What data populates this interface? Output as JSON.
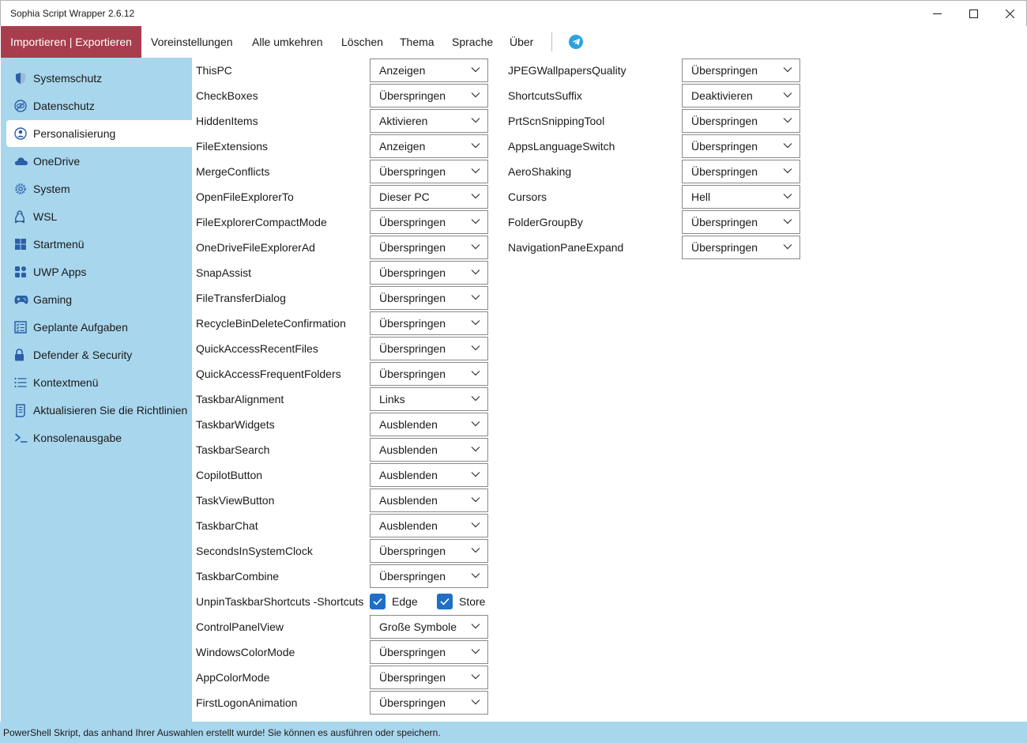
{
  "window": {
    "title": "Sophia Script Wrapper 2.6.12"
  },
  "menu": {
    "active": "Importieren | Exportieren",
    "items": [
      "Voreinstellungen",
      "Alle umkehren",
      "Löschen",
      "Thema",
      "Sprache",
      "Über"
    ],
    "telegram_icon": "telegram-icon"
  },
  "sidebar": {
    "items": [
      {
        "label": "Systemschutz",
        "icon": "shield-icon"
      },
      {
        "label": "Datenschutz",
        "icon": "eye-icon"
      },
      {
        "label": "Personalisierung",
        "icon": "user-icon"
      },
      {
        "label": "OneDrive",
        "icon": "cloud-icon"
      },
      {
        "label": "System",
        "icon": "gear-icon"
      },
      {
        "label": "WSL",
        "icon": "linux-icon"
      },
      {
        "label": "Startmenü",
        "icon": "windows-icon"
      },
      {
        "label": "UWP Apps",
        "icon": "apps-icon"
      },
      {
        "label": "Gaming",
        "icon": "gamepad-icon"
      },
      {
        "label": "Geplante Aufgaben",
        "icon": "tasklist-icon"
      },
      {
        "label": "Defender & Security",
        "icon": "lock-icon"
      },
      {
        "label": "Kontextmenü",
        "icon": "list-icon"
      },
      {
        "label": "Aktualisieren Sie die Richtlinien",
        "icon": "scroll-icon"
      },
      {
        "label": "Konsolenausgabe",
        "icon": "console-icon"
      }
    ],
    "selected": "Personalisierung"
  },
  "left_settings": [
    {
      "name": "ThisPC",
      "value": "Anzeigen"
    },
    {
      "name": "CheckBoxes",
      "value": "Überspringen"
    },
    {
      "name": "HiddenItems",
      "value": "Aktivieren"
    },
    {
      "name": "FileExtensions",
      "value": "Anzeigen"
    },
    {
      "name": "MergeConflicts",
      "value": "Überspringen"
    },
    {
      "name": "OpenFileExplorerTo",
      "value": "Dieser PC"
    },
    {
      "name": "FileExplorerCompactMode",
      "value": "Überspringen"
    },
    {
      "name": "OneDriveFileExplorerAd",
      "value": "Überspringen"
    },
    {
      "name": "SnapAssist",
      "value": "Überspringen"
    },
    {
      "name": "FileTransferDialog",
      "value": "Überspringen"
    },
    {
      "name": "RecycleBinDeleteConfirmation",
      "value": "Überspringen"
    },
    {
      "name": "QuickAccessRecentFiles",
      "value": "Überspringen"
    },
    {
      "name": "QuickAccessFrequentFolders",
      "value": "Überspringen"
    },
    {
      "name": "TaskbarAlignment",
      "value": "Links"
    },
    {
      "name": "TaskbarWidgets",
      "value": "Ausblenden"
    },
    {
      "name": "TaskbarSearch",
      "value": "Ausblenden"
    },
    {
      "name": "CopilotButton",
      "value": "Ausblenden"
    },
    {
      "name": "TaskViewButton",
      "value": "Ausblenden"
    },
    {
      "name": "TaskbarChat",
      "value": "Ausblenden"
    },
    {
      "name": "SecondsInSystemClock",
      "value": "Überspringen"
    },
    {
      "name": "TaskbarCombine",
      "value": "Überspringen"
    },
    {
      "name": "UnpinTaskbarShortcuts -Shortcuts",
      "checkboxes": [
        {
          "label": "Edge",
          "checked": true
        },
        {
          "label": "Store",
          "checked": true
        }
      ]
    },
    {
      "name": "ControlPanelView",
      "value": "Große Symbole"
    },
    {
      "name": "WindowsColorMode",
      "value": "Überspringen"
    },
    {
      "name": "AppColorMode",
      "value": "Überspringen"
    },
    {
      "name": "FirstLogonAnimation",
      "value": "Überspringen"
    }
  ],
  "right_settings": [
    {
      "name": "JPEGWallpapersQuality",
      "value": "Überspringen"
    },
    {
      "name": "ShortcutsSuffix",
      "value": "Deaktivieren"
    },
    {
      "name": "PrtScnSnippingTool",
      "value": "Überspringen"
    },
    {
      "name": "AppsLanguageSwitch",
      "value": "Überspringen"
    },
    {
      "name": "AeroShaking",
      "value": "Überspringen"
    },
    {
      "name": "Cursors",
      "value": "Hell"
    },
    {
      "name": "FolderGroupBy",
      "value": "Überspringen"
    },
    {
      "name": "NavigationPaneExpand",
      "value": "Überspringen"
    }
  ],
  "status": {
    "text": "PowerShell Skript, das anhand Ihrer Auswahlen erstellt wurde! Sie können es ausführen oder speichern."
  },
  "colors": {
    "accent": "#a83d4d",
    "sidebar_bg": "#a8d6ed",
    "checkbox": "#1f6fc4",
    "telegram": "#2aa3e0"
  }
}
